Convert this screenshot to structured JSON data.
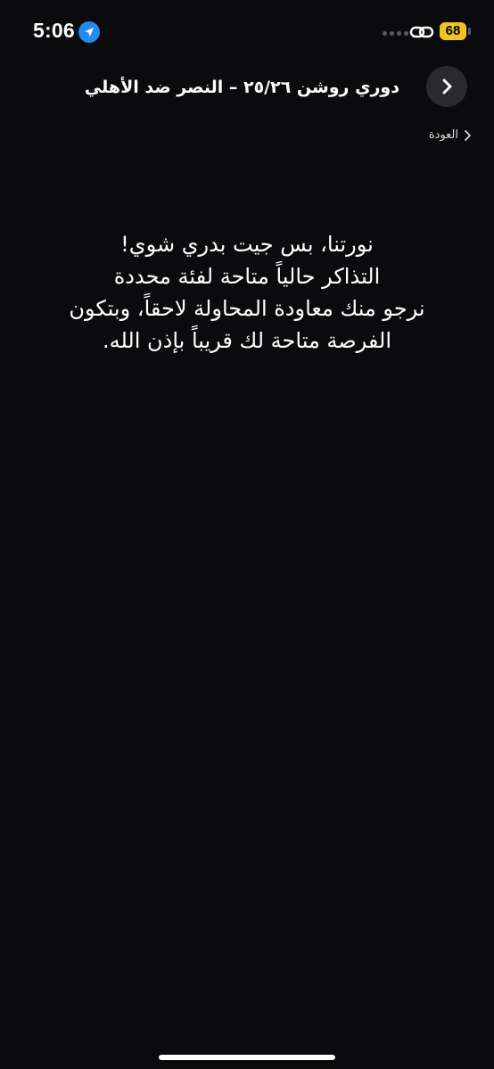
{
  "status_bar": {
    "time": "5:06",
    "battery": "68",
    "icons": [
      "location-arrow-icon",
      "signal-dots-icon",
      "link-icon",
      "battery-icon"
    ]
  },
  "header": {
    "title": "دوري روشن ٢٥/٢٦ – النصر ضد الأهلي",
    "nav_icon": "chevron-right-icon"
  },
  "back": {
    "label": "العودة",
    "icon": "chevron-left-icon"
  },
  "message": {
    "lines": [
      "نورتنا، بس جيت بدري شوي!",
      "التذاكر حالياً متاحة لفئة محددة",
      "نرجو منك معاودة المحاولة لاحقاً، وبتكون",
      "الفرصة متاحة لك قريباً بإذن الله."
    ]
  },
  "colors": {
    "background": "#0b0b0d",
    "battery": "#f5c518",
    "accent_location": "#1e8cf0"
  }
}
